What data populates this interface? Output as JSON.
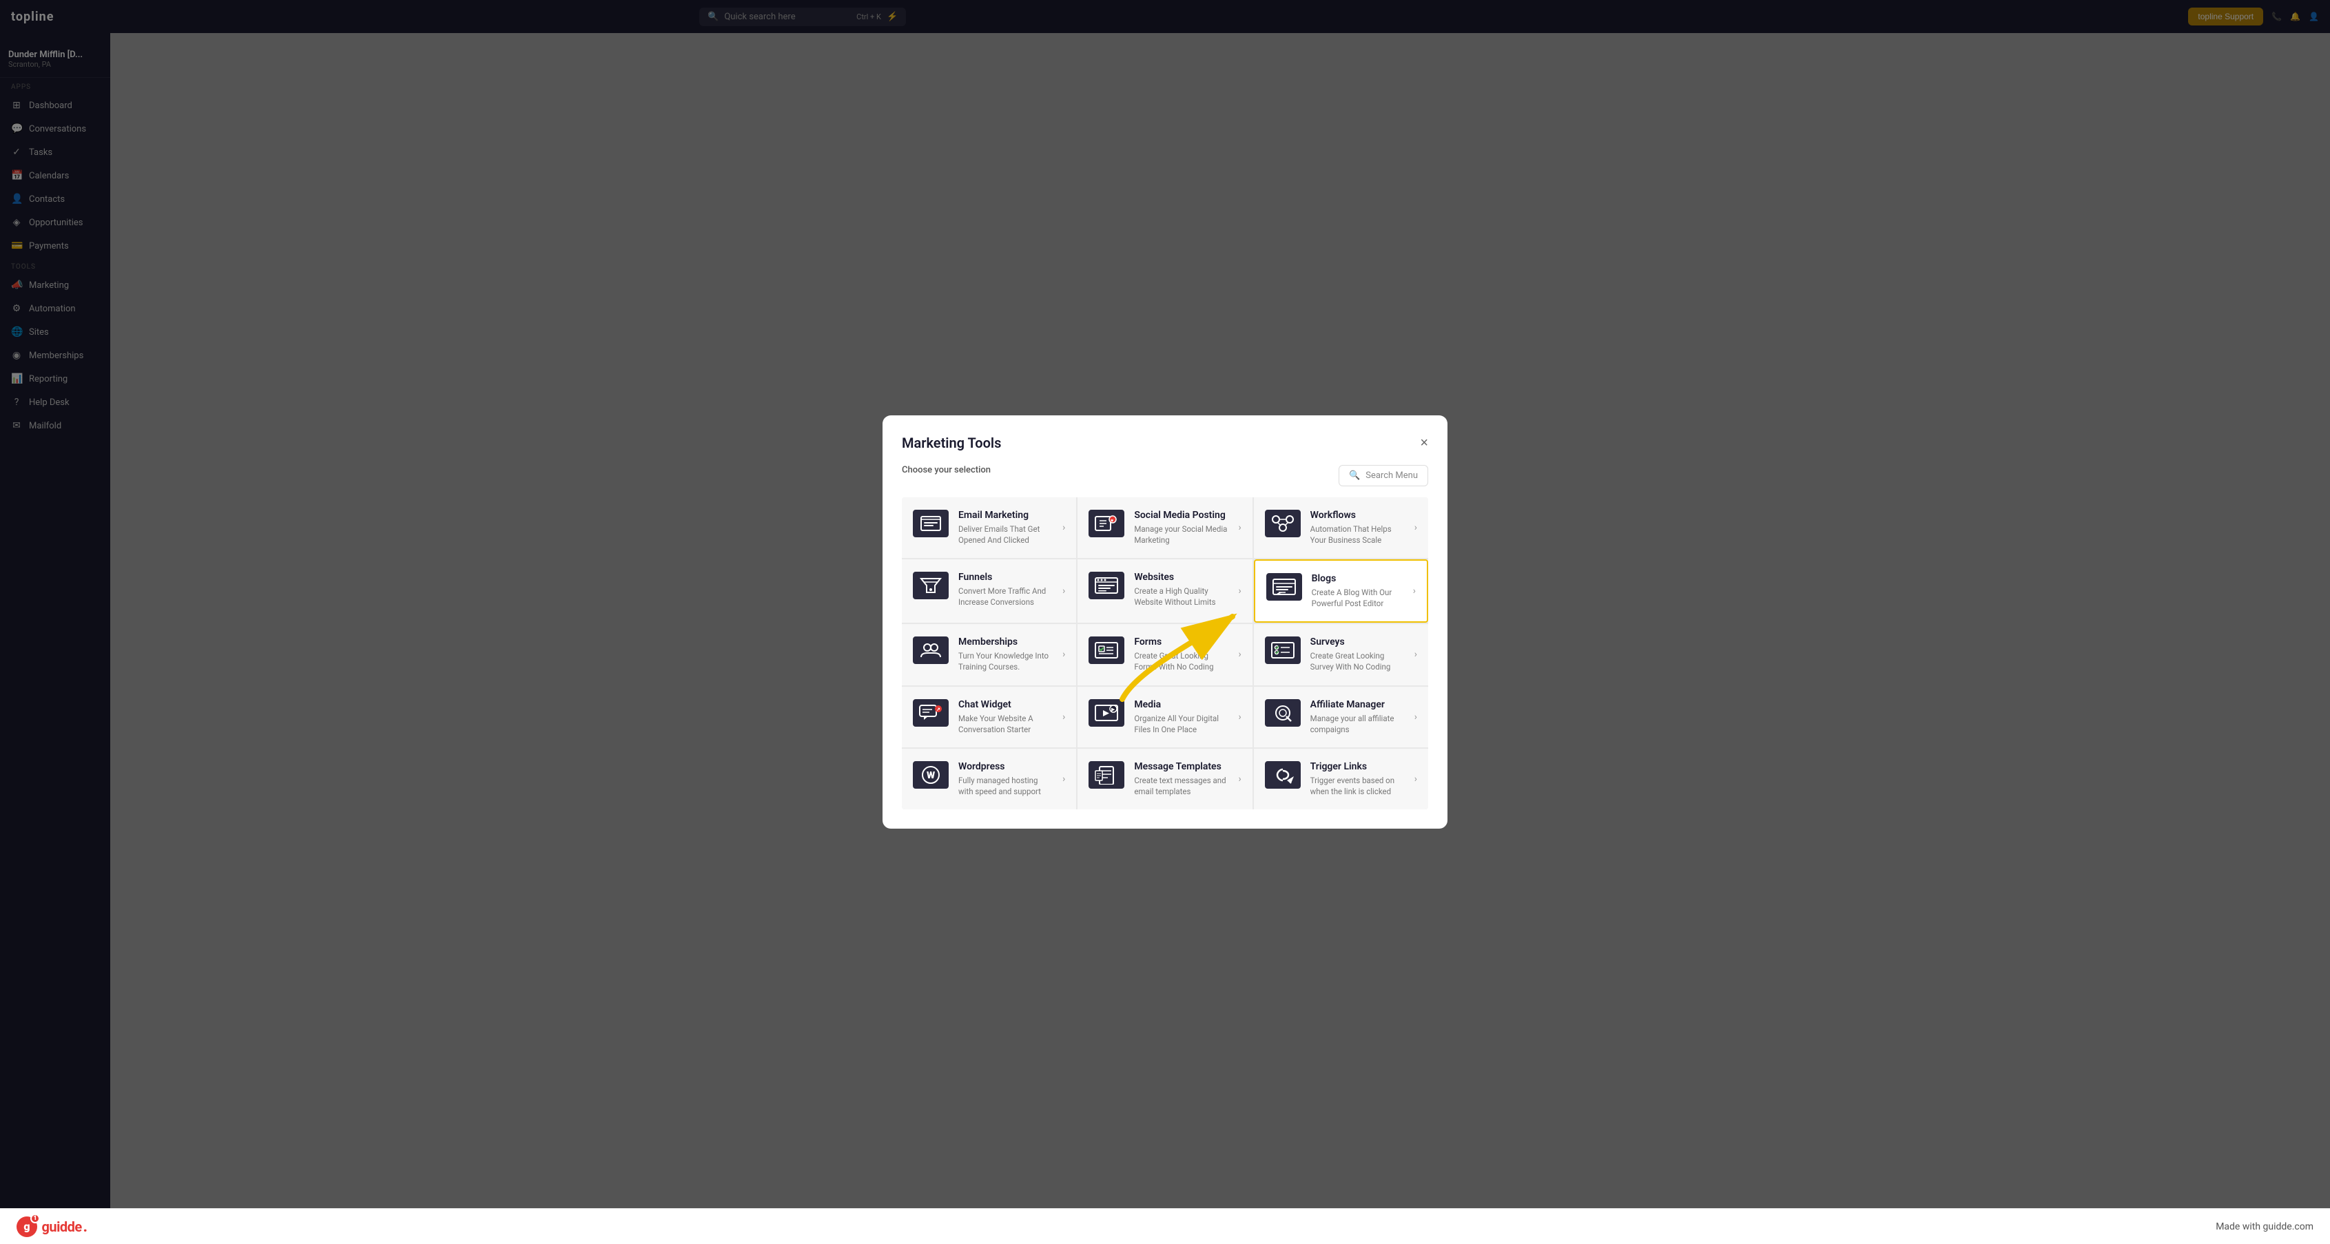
{
  "brand": {
    "logo": "topline"
  },
  "navbar": {
    "search_placeholder": "Quick search here",
    "shortcut": "Ctrl + K",
    "support_label": "topline Support"
  },
  "sidebar": {
    "apps_label": "Apps",
    "tools_label": "Tools",
    "items": [
      {
        "label": "Dashboard",
        "icon": "⊞"
      },
      {
        "label": "Conversations",
        "icon": "💬"
      },
      {
        "label": "Tasks",
        "icon": "✓"
      },
      {
        "label": "Calendars",
        "icon": "📅"
      },
      {
        "label": "Contacts",
        "icon": "👤"
      },
      {
        "label": "Opportunities",
        "icon": "◈"
      },
      {
        "label": "Payments",
        "icon": "💳"
      },
      {
        "label": "Marketing",
        "icon": "📣"
      },
      {
        "label": "Automation",
        "icon": "⚙"
      },
      {
        "label": "Sites",
        "icon": "🌐"
      },
      {
        "label": "Memberships",
        "icon": "◉"
      },
      {
        "label": "Reporting",
        "icon": "📊"
      },
      {
        "label": "Help Desk",
        "icon": "?"
      },
      {
        "label": "Mailfold",
        "icon": "✉"
      }
    ]
  },
  "workspace": {
    "name": "Dunder Mifflin [D...",
    "location": "Scranton, PA"
  },
  "modal": {
    "title": "Marketing Tools",
    "close_label": "×",
    "subtitle": "Choose your selection",
    "search_placeholder": "Search Menu",
    "tools": [
      {
        "name": "Email Marketing",
        "desc": "Deliver Emails That Get Opened And Clicked",
        "icon": "✉",
        "highlighted": false
      },
      {
        "name": "Social Media Posting",
        "desc": "Manage your Social Media Marketing",
        "icon": "📱",
        "highlighted": false
      },
      {
        "name": "Workflows",
        "desc": "Automation That Helps Your Business Scale",
        "icon": "⚡",
        "highlighted": false
      },
      {
        "name": "Funnels",
        "desc": "Convert More Traffic And Increase Conversions",
        "icon": "▼",
        "highlighted": false
      },
      {
        "name": "Websites",
        "desc": "Create a High Quality Website Without Limits",
        "icon": "🖥",
        "highlighted": false
      },
      {
        "name": "Blogs",
        "desc": "Create A Blog With Our Powerful Post Editor",
        "icon": "📝",
        "highlighted": true
      },
      {
        "name": "Memberships",
        "desc": "Turn Your Knowledge Into Training Courses.",
        "icon": "👥",
        "highlighted": false
      },
      {
        "name": "Forms",
        "desc": "Create Great Looking Forms With No Coding",
        "icon": "☑",
        "highlighted": false
      },
      {
        "name": "Surveys",
        "desc": "Create Great Looking Survey With No Coding",
        "icon": "☑",
        "highlighted": false
      },
      {
        "name": "Chat Widget",
        "desc": "Make Your Website A Conversation Starter",
        "icon": "💬",
        "highlighted": false
      },
      {
        "name": "Media",
        "desc": "Organize All Your Digital Files In One Place",
        "icon": "▶",
        "highlighted": false
      },
      {
        "name": "Affiliate Manager",
        "desc": "Manage your all affiliate compaigns",
        "icon": "🔍",
        "highlighted": false
      },
      {
        "name": "Wordpress",
        "desc": "Fully managed hosting with speed and support",
        "icon": "W",
        "highlighted": false
      },
      {
        "name": "Message Templates",
        "desc": "Create text messages and email templates",
        "icon": "✉",
        "highlighted": false
      },
      {
        "name": "Trigger Links",
        "desc": "Trigger events based on when the link is clicked",
        "icon": "🔗",
        "highlighted": false
      }
    ]
  },
  "footer": {
    "brand": "guidde.",
    "tagline": "Made with guidde.com",
    "badge": "1"
  }
}
